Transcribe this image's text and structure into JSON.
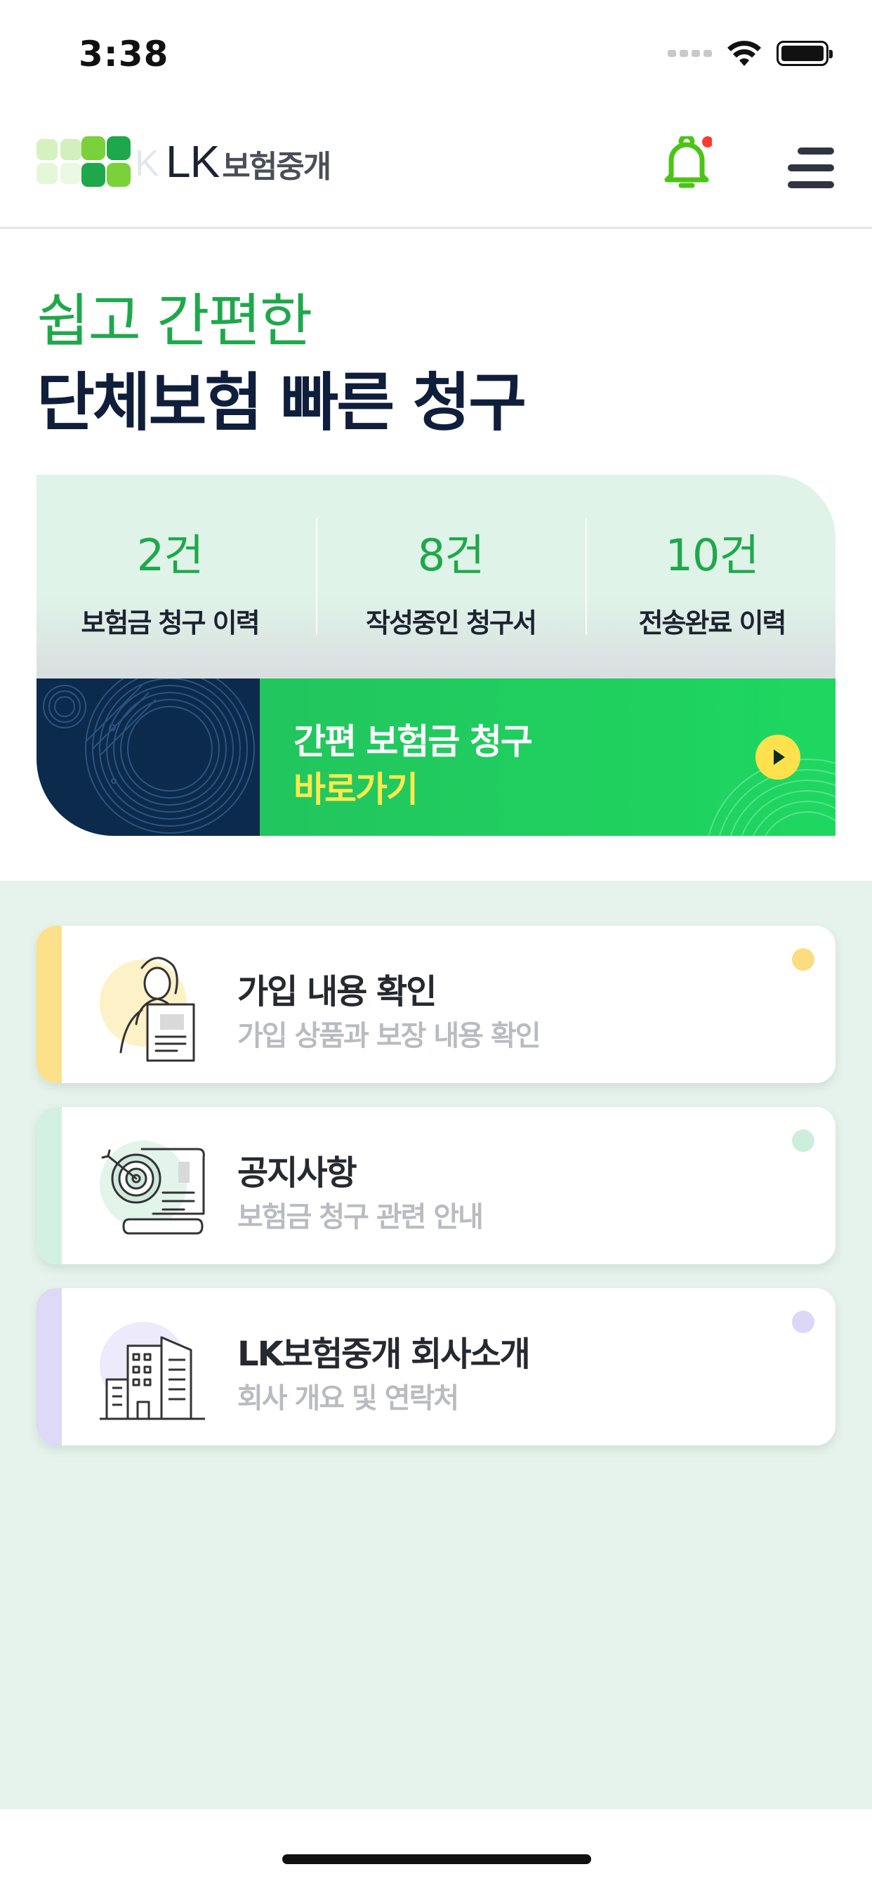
{
  "status_bar": {
    "time": "3:38"
  },
  "header": {
    "logo_lk": "LK",
    "logo_kor": "보험중개",
    "notification_badge_color": "#ff3b30",
    "bell_color": "#4cc417"
  },
  "hero": {
    "line1": "쉽고 간편한",
    "line2": "단체보험 빠른 청구"
  },
  "stats": [
    {
      "count": "2건",
      "label": "보험금 청구 이력"
    },
    {
      "count": "8건",
      "label": "작성중인 청구서"
    },
    {
      "count": "10건",
      "label": "전송완료 이력"
    }
  ],
  "claim_banner": {
    "title": "간편 보험금 청구",
    "link": "바로가기"
  },
  "menu": [
    {
      "title": "가입 내용 확인",
      "subtitle": "가입 상품과 보장 내용 확인",
      "icon": "person-with-document-icon",
      "accent": "#fde08a"
    },
    {
      "title": "공지사항",
      "subtitle": "보험금 청구 관련 안내",
      "icon": "target-scroll-icon",
      "accent": "#d3f1e2"
    },
    {
      "title": "LK보험중개 회사소개",
      "subtitle": "회사 개요 및 연락처",
      "icon": "building-icon",
      "accent": "#ddd9f6"
    }
  ],
  "colors": {
    "brand_green": "#1fa84b",
    "navy": "#0f1e3a",
    "section_bg": "#e6f3ec"
  }
}
